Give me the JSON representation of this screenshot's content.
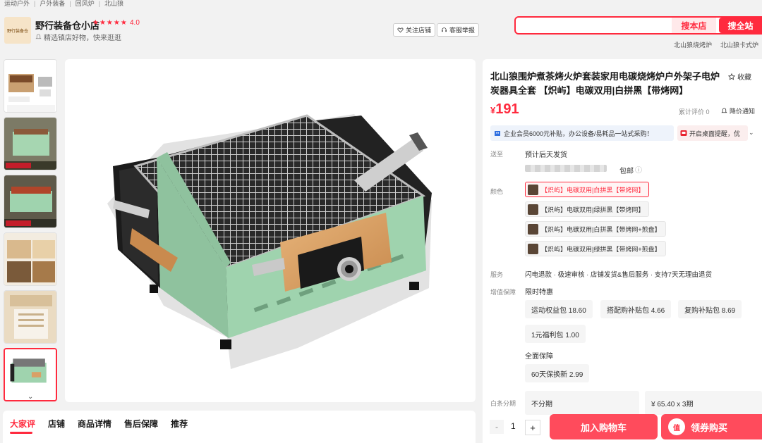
{
  "breadcrumb": [
    "运动户外",
    "户外装备",
    "回风炉",
    "北山狼"
  ],
  "shop": {
    "logo_text": "野行装备仓",
    "name": "野行装备仓小店",
    "rating_stars": "★★★★★",
    "rating": "4.0",
    "desc": "精选镇店好物，快来逛逛",
    "follow_label": "关注店铺",
    "report_label": "客服举报"
  },
  "search": {
    "placeholder": "",
    "shop_search_label": "搜本店",
    "all_search_label": "搜全站",
    "hot_words": [
      "北山狼烧烤炉",
      "北山狼卡式炉"
    ]
  },
  "tabs": [
    "大家评",
    "店铺",
    "商品详情",
    "售后保障",
    "推荐"
  ],
  "product": {
    "title": "北山狼围炉煮茶烤火炉套装家用电碳烧烤炉户外架子电炉炭器具全套 【炽屿】电碳双用|白拼黑【带烤网】",
    "fav_label": "收藏",
    "currency": "¥",
    "price": "191",
    "reviews_label": "累计评价 0",
    "price_notify_label": "降价通知",
    "promo_enterprise": "企业会员6000元补贴，办公设备/易耗品一站式采购！",
    "promo_desktop": "开启桌面提醒，优"
  },
  "delivery": {
    "label": "送至",
    "ship_text": "预计后天发货",
    "postage": "包邮"
  },
  "color": {
    "label": "颜色",
    "options": [
      "【炽屿】电碳双用|白拼黑【带烤网】",
      "【炽屿】电碳双用|绿拼黑【带烤网】",
      "【炽屿】电碳双用|白拼黑【带烤网+煎盘】",
      "【炽屿】电碳双用|绿拼黑【带烤网+煎盘】"
    ]
  },
  "service": {
    "label": "服务",
    "text": "闪电退款 · 极速审核 · 店铺发货&售后服务 · 支持7天无理由退货"
  },
  "guarantee": {
    "label": "增值保障",
    "limited_title": "限时特惠",
    "limited_chips": [
      "运动权益包 18.60",
      "搭配购补贴包 4.66",
      "复购补贴包 8.69",
      "1元福利包 1.00"
    ],
    "full_title": "全面保障",
    "full_chips": [
      "60天保换新 2.99"
    ]
  },
  "installment": {
    "label": "白条分期",
    "options": [
      "不分期",
      "¥ 65.40 x 3期"
    ]
  },
  "purchase": {
    "quantity": "1",
    "minus": "-",
    "plus": "+",
    "add_cart_label": "加入购物车",
    "buy_label": "领券购买",
    "badge_text": "值"
  },
  "colors": {
    "accent": "#ff2a3e",
    "cart_button": "#ff4b5c",
    "grill_body": "#9fd3ae"
  }
}
